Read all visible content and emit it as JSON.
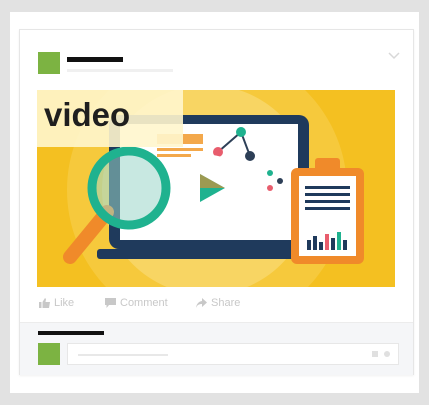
{
  "post": {
    "video_label": "video",
    "actions": {
      "like": "Like",
      "comment": "Comment",
      "share": "Share"
    }
  },
  "colors": {
    "brand_green": "#7cb342",
    "media_yellow": "#f4c021",
    "accent_teal": "#1fb28f",
    "accent_orange": "#f08a2a"
  },
  "icons": [
    "chevron-down-icon",
    "magnifier-icon",
    "play-icon",
    "clipboard-icon",
    "like-icon",
    "comment-icon",
    "share-icon"
  ]
}
